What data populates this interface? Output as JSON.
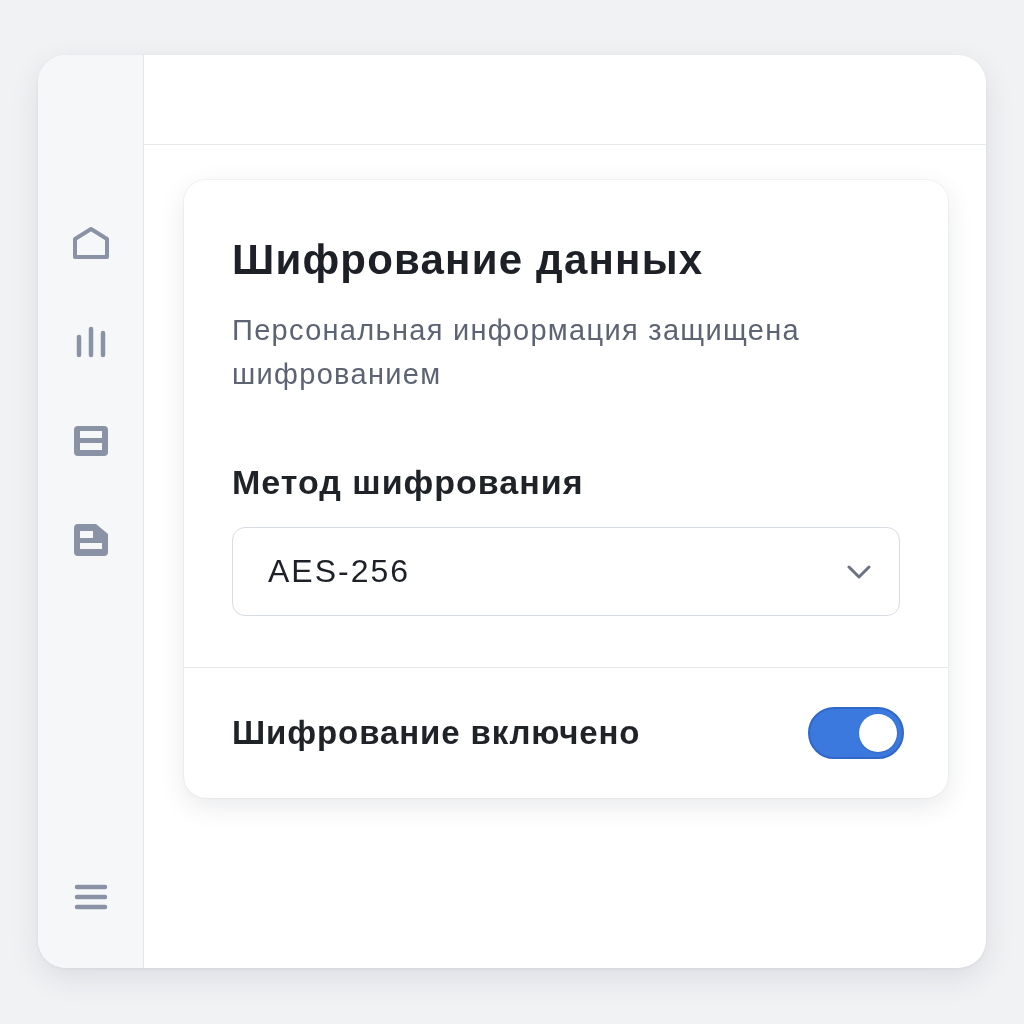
{
  "card": {
    "title": "Шифрование данных",
    "description": "Персональная информация защищена шифрованием"
  },
  "method": {
    "label": "Метод шифрования",
    "value": "AES-256"
  },
  "toggle": {
    "label": "Шифрование включено",
    "on": true
  }
}
